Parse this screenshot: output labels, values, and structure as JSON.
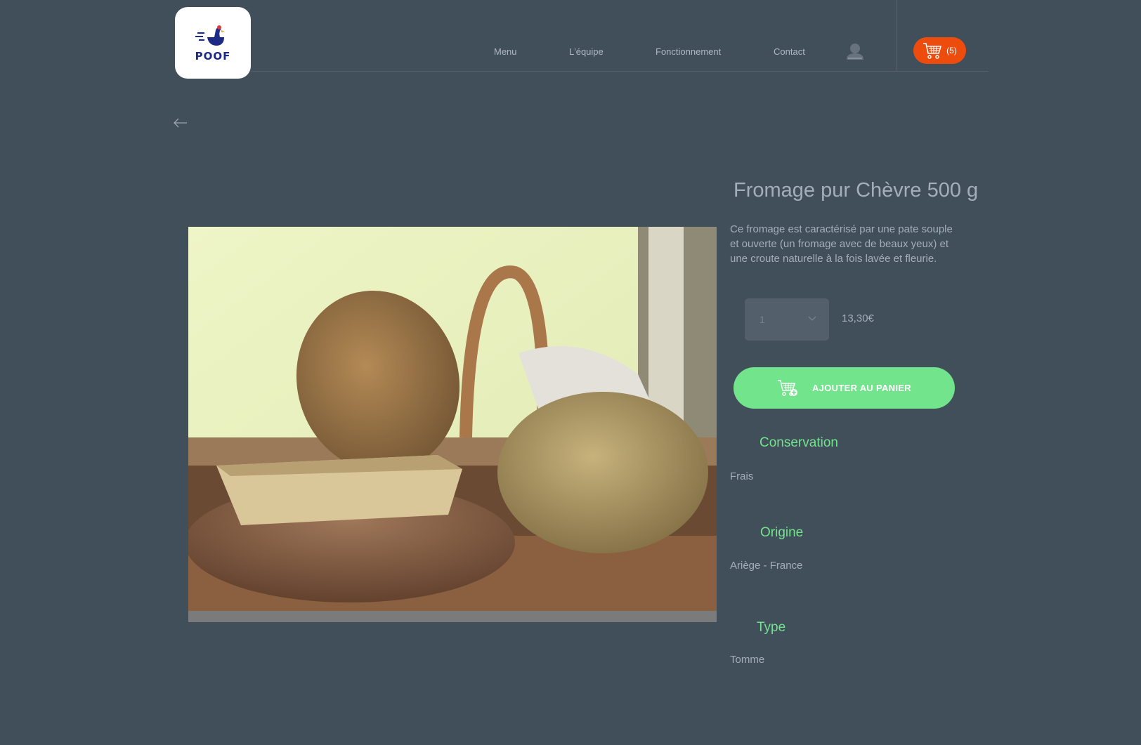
{
  "header": {
    "logo_text": "POOF",
    "nav": [
      "Menu",
      "L'équipe",
      "Fonctionnement",
      "Contact"
    ],
    "cart_count": "(5)",
    "icons": {
      "user": "user-icon",
      "cart": "cart-icon",
      "back": "back-arrow-icon"
    }
  },
  "product": {
    "title": "Fromage pur Chèvre 500 g",
    "description": "Ce fromage est caractérisé par une pate souple et ouverte (un fromage avec de beaux yeux) et une croute naturelle à la fois lavée et fleurie.",
    "quantity": "1",
    "price": "13,30€",
    "add_to_cart_label": "AJOUTER AU PANIER",
    "image_alt": "cheese-photo"
  },
  "details": {
    "conservation": {
      "title": "Conservation",
      "value": "Frais"
    },
    "origin": {
      "title": "Origine",
      "value": "Ariège - France"
    },
    "type": {
      "title": "Type",
      "value": "Tomme"
    }
  },
  "colors": {
    "background": "#414f5b",
    "accent_green": "#72e48b",
    "cart_orange": "#ee4c0d",
    "logo_blue": "#1c2a86",
    "text_muted": "#a3aeb8"
  }
}
